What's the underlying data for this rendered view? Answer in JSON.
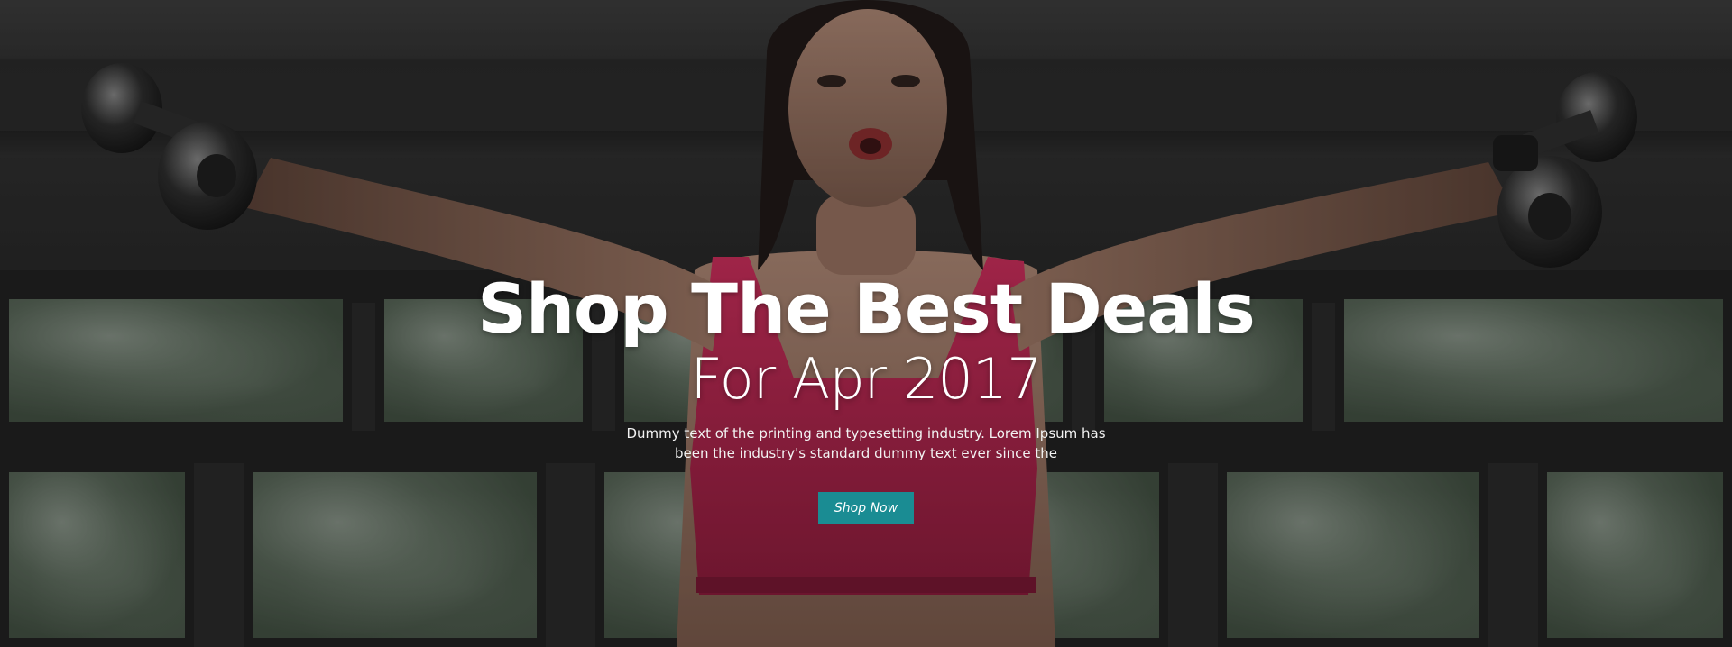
{
  "hero": {
    "headline": "Shop The Best Deals",
    "subheadline": "For Apr 2017",
    "body": "Dummy text of the printing and typesetting industry. Lorem Ipsum has been the industry's standard dummy text ever since the",
    "cta_label": "Shop Now"
  },
  "colors": {
    "cta_background": "#1a8c93",
    "text": "#ffffff",
    "top_color": "#d42a5b"
  },
  "icons": {
    "left_weight": "dumbbell-icon",
    "right_weight": "dumbbell-icon"
  }
}
